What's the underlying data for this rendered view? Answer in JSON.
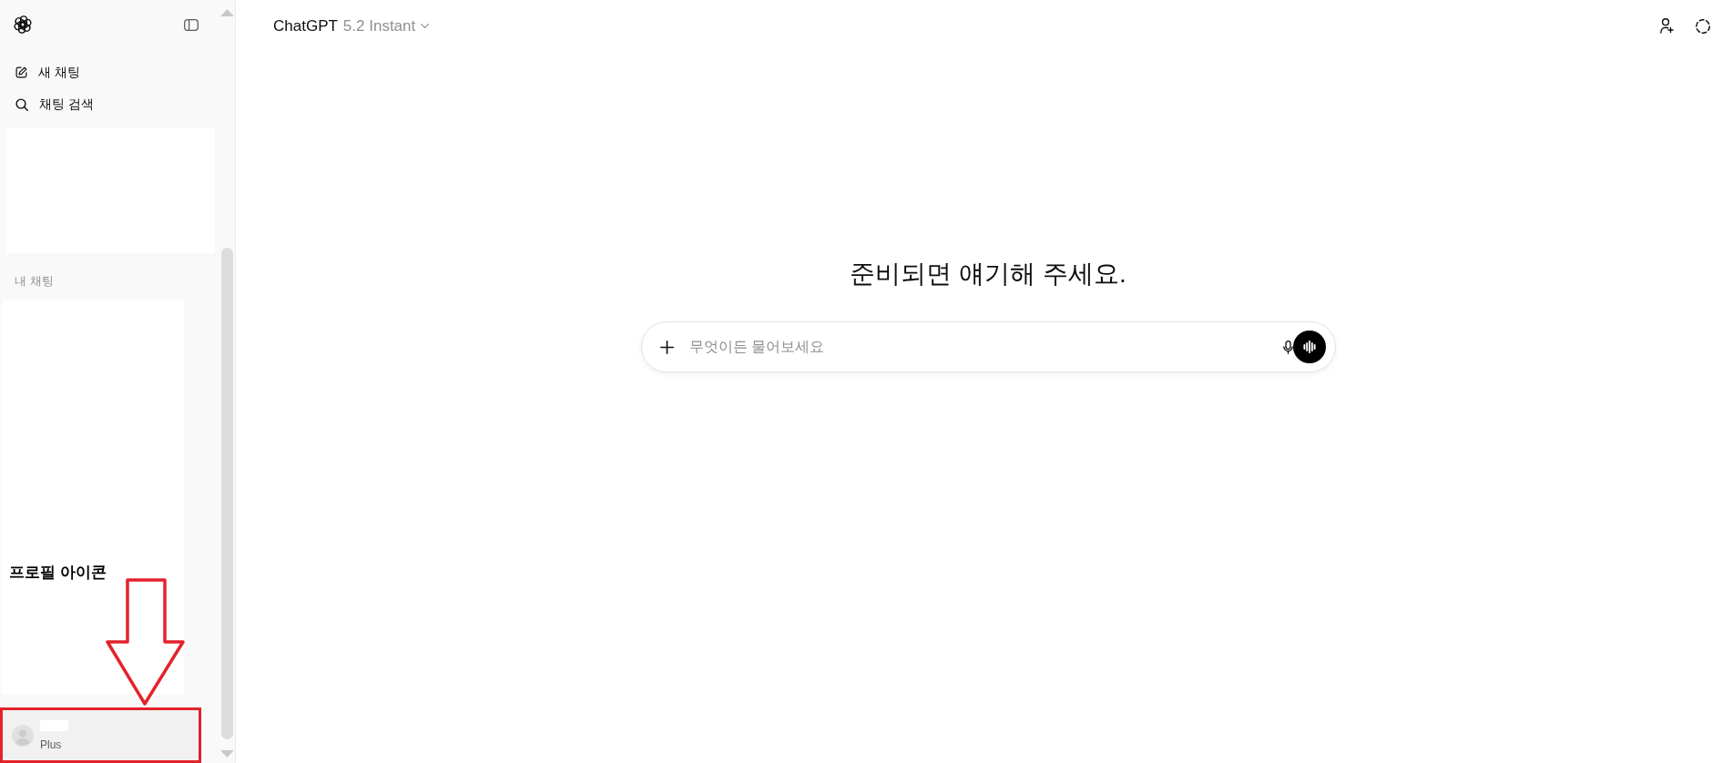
{
  "sidebar": {
    "nav_items": [
      {
        "label": "새 채팅"
      },
      {
        "label": "채팅 검색"
      }
    ],
    "section_title": "내 채팅",
    "profile": {
      "plan": "Plus"
    }
  },
  "annotation": {
    "label": "프로필 아이콘"
  },
  "header": {
    "model": {
      "name": "ChatGPT",
      "version": "5.2 Instant"
    }
  },
  "main": {
    "heading": "준비되면 얘기해 주세요.",
    "composer": {
      "placeholder": "무엇이든 물어보세요"
    }
  }
}
